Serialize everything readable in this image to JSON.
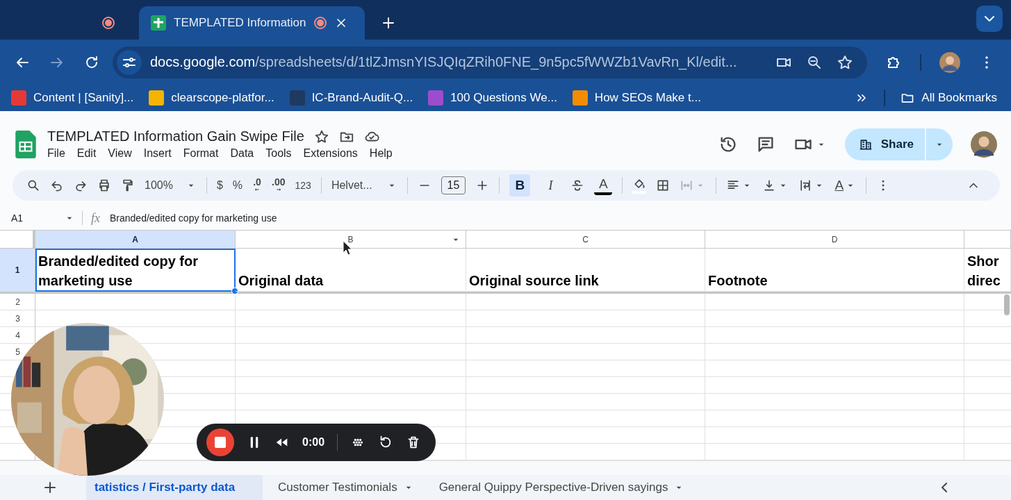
{
  "browser": {
    "tabs": [
      {
        "selected": false,
        "recording": true
      },
      {
        "title": "TEMPLATED Information",
        "selected": true,
        "recording": true
      }
    ],
    "url": {
      "host": "docs.google.com",
      "path": "/spreadsheets/d/1tlZJmsnYISJQIqZRih0FNE_9n5pc5fWWZb1VavRn_Kl/edit..."
    },
    "bookmarks": [
      {
        "label": "Content | [Sanity]...",
        "color": "#e53935"
      },
      {
        "label": "clearscope-platfor...",
        "color": "#f4b400"
      },
      {
        "label": "IC-Brand-Audit-Q...",
        "color": "#1f3a5f"
      },
      {
        "label": "100 Questions We...",
        "color": "#9c4dcc"
      },
      {
        "label": "How SEOs Make t...",
        "color": "#f28c00"
      }
    ],
    "all_bookmarks": "All Bookmarks"
  },
  "doc": {
    "title": "TEMPLATED Information Gain Swipe File",
    "menus": [
      "File",
      "Edit",
      "View",
      "Insert",
      "Format",
      "Data",
      "Tools",
      "Extensions",
      "Help"
    ],
    "share": "Share"
  },
  "toolbar": {
    "zoom": "100%",
    "currency": "$",
    "percent": "%",
    "decrease_decimal": ".0",
    "increase_decimal": ".00",
    "number_format": "123",
    "font": "Helvet...",
    "font_size": "15",
    "bold": {
      "label": "B",
      "on": true
    },
    "italic": {
      "label": "I",
      "on": false
    },
    "text_color": "A",
    "merge_disabled": true,
    "text_rotation": "A"
  },
  "formula_bar": {
    "cell": "A1",
    "fx": "fx",
    "content": "Branded/edited copy for marketing use"
  },
  "sheet": {
    "columns": [
      {
        "label": "A",
        "selected": true,
        "menu": false
      },
      {
        "label": "B",
        "selected": false,
        "menu": true
      },
      {
        "label": "C",
        "selected": false,
        "menu": false
      },
      {
        "label": "D",
        "selected": false,
        "menu": false
      },
      {
        "selected": false,
        "menu": false
      }
    ],
    "rows": [
      {
        "number": "1",
        "selected": true,
        "cells": [
          "Branded/edited copy for marketing use",
          "Original data",
          "Original source link",
          "Footnote",
          "Shor direc"
        ]
      },
      {
        "number": "2",
        "selected": false
      },
      {
        "number": "3",
        "selected": false
      },
      {
        "number": "4",
        "selected": false
      },
      {
        "number": "5",
        "selected": false
      },
      {
        "selected": false
      },
      {
        "selected": false
      },
      {
        "selected": false
      },
      {
        "selected": false
      },
      {
        "selected": false
      },
      {
        "selected": false
      }
    ]
  },
  "recorder": {
    "time": "0:00"
  },
  "sheet_tabs": [
    {
      "label": "tatistics / First-party data",
      "selected": true,
      "menu": false
    },
    {
      "label": "Customer Testimonials",
      "selected": false,
      "menu": true
    },
    {
      "label": "General Quippy Perspective-Driven sayings",
      "selected": false,
      "menu": true
    }
  ]
}
